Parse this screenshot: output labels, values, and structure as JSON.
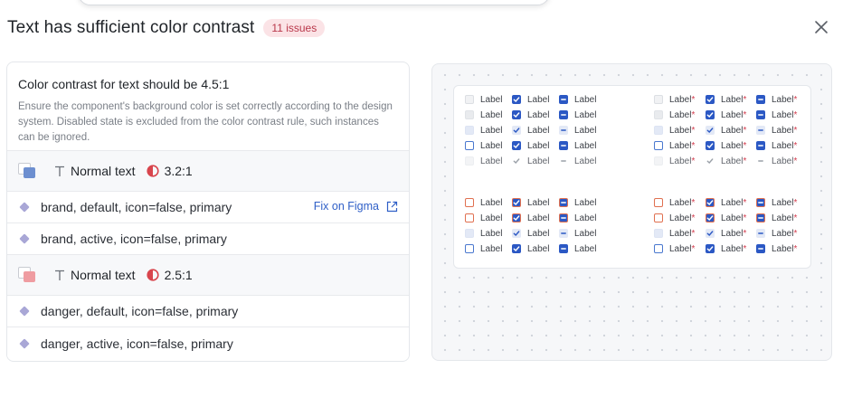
{
  "header": {
    "title": "Text has sufficient color contrast",
    "issues_badge": "11 issues"
  },
  "rule": {
    "title": "Color contrast for text should be 4.5:1",
    "description": "Ensure the component's background color is set correctly according to the design system. Disabled state is excluded from the color contrast rule, such instances can be ignored."
  },
  "groups": [
    {
      "label": "Normal text",
      "ratio": "3.2:1",
      "swatch_color": "#6d8fd0",
      "items": [
        {
          "label": "brand, default, icon=false, primary",
          "action": "Fix on Figma"
        },
        {
          "label": "brand, active, icon=false, primary"
        }
      ]
    },
    {
      "label": "Normal text",
      "ratio": "2.5:1",
      "swatch_color": "#ef9ca1",
      "items": [
        {
          "label": "danger, default, icon=false, primary"
        },
        {
          "label": "danger, active, icon=false, primary"
        }
      ]
    }
  ],
  "preview": {
    "label": "Label",
    "required_mark": "*"
  },
  "colors": {
    "brand": "#2b58c4",
    "danger_badge_text": "#b9384b",
    "danger_badge_bg": "#fbe3e6",
    "contrast_icon": "#d8454d",
    "link": "#2f5fc7",
    "danger_border": "#e07050"
  }
}
